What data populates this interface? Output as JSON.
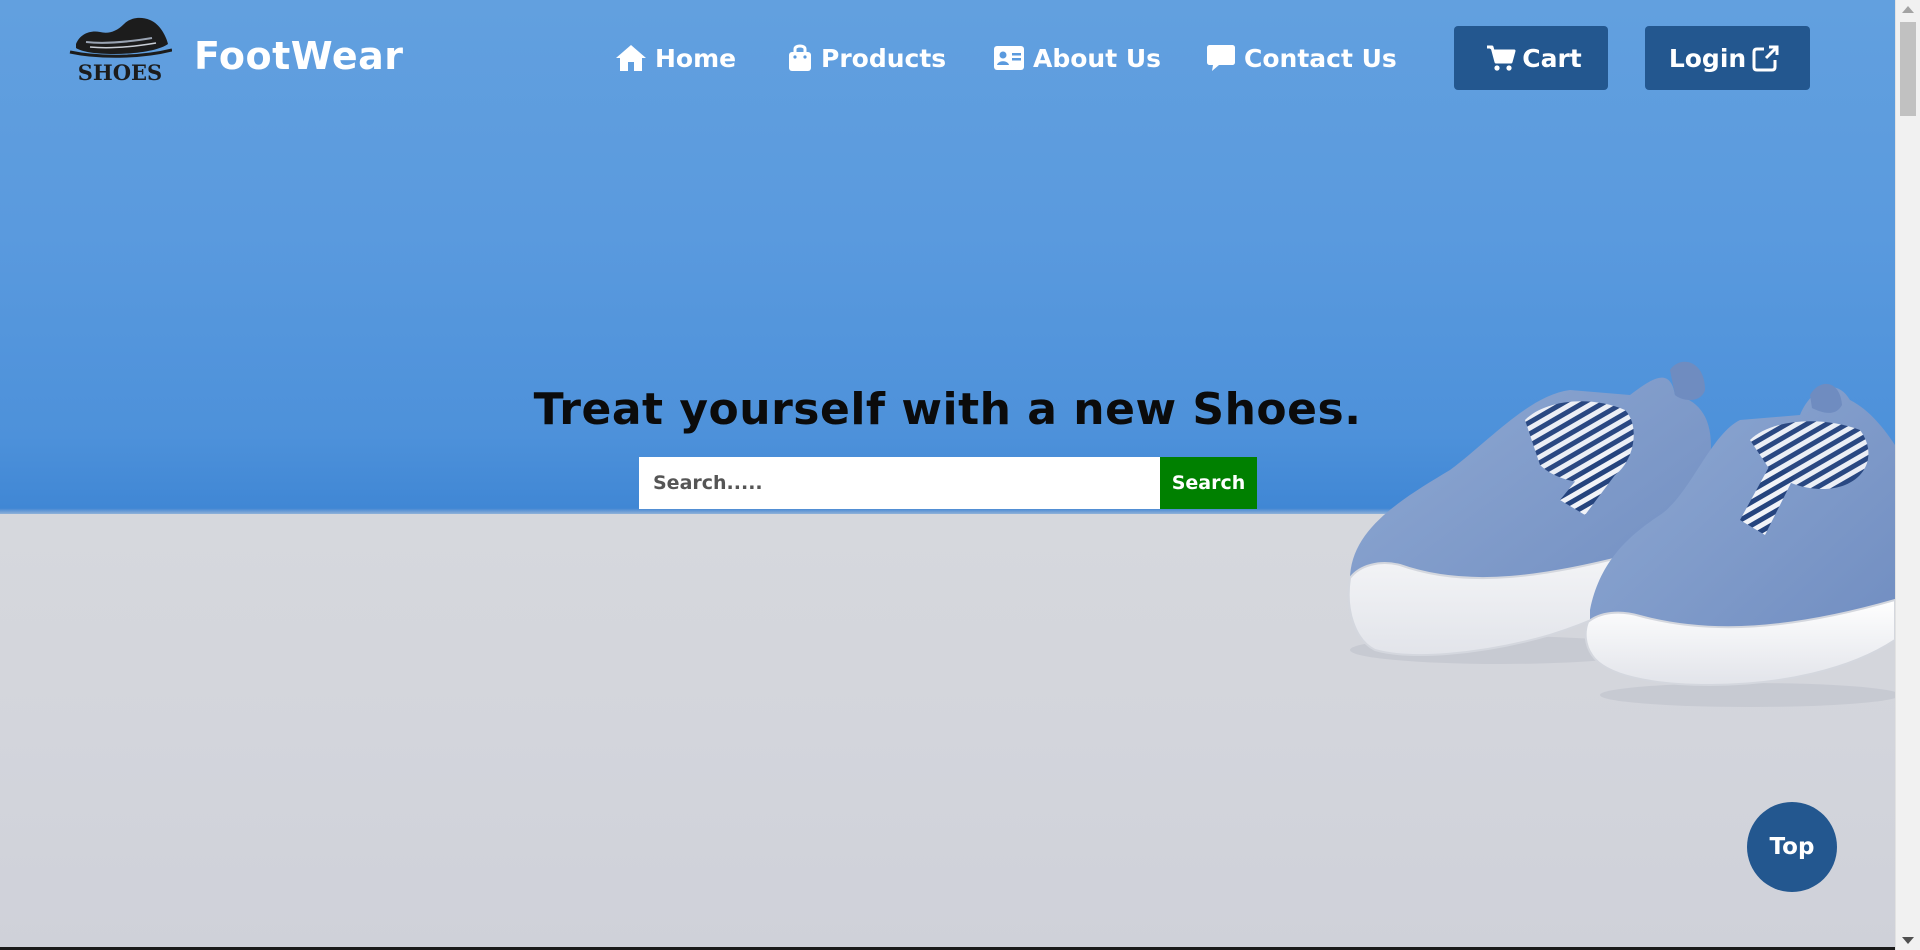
{
  "brand": {
    "logo_text": "SHOES",
    "name": "FootWear"
  },
  "nav": {
    "items": [
      {
        "label": "Home",
        "icon": "home-icon"
      },
      {
        "label": "Products",
        "icon": "shopping-bag-icon"
      },
      {
        "label": "About Us",
        "icon": "id-card-icon"
      },
      {
        "label": "Contact Us",
        "icon": "chat-bubble-icon"
      }
    ],
    "cart_label": "Cart",
    "login_label": "Login"
  },
  "hero": {
    "title": "Treat yourself with a new Shoes.",
    "search_placeholder": "Search.....",
    "search_button": "Search"
  },
  "top_button": "Top",
  "colors": {
    "wall": "#5a9ade",
    "floor": "#d4d6dc",
    "button_dark": "#23578f",
    "search_button": "#008000",
    "nav_text": "#ffffff"
  }
}
